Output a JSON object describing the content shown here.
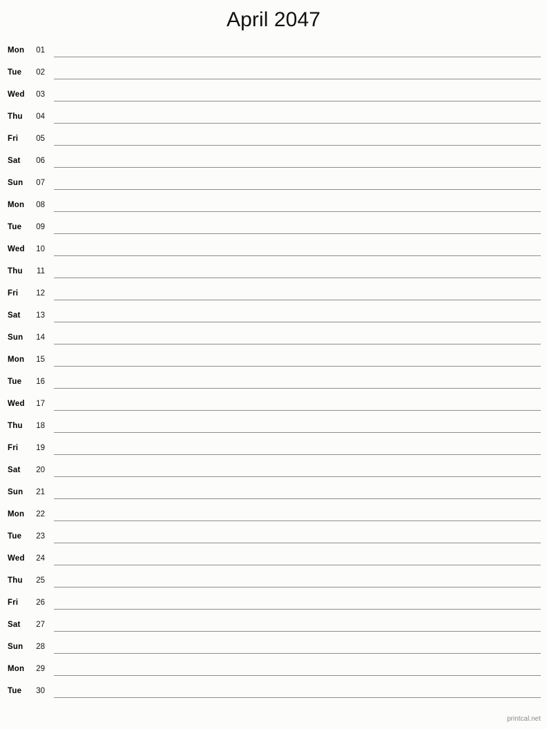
{
  "document": {
    "title": "April 2047",
    "month": "April",
    "year": "2047",
    "type": "printable-notebook-calendar",
    "background_color": "#fcfcfa",
    "line_color": "#8d8d8a",
    "text_color": "#000000"
  },
  "footer": {
    "text": "printcal.net",
    "color": "#8a8a88"
  },
  "days": [
    {
      "weekday": "Mon",
      "date": "01"
    },
    {
      "weekday": "Tue",
      "date": "02"
    },
    {
      "weekday": "Wed",
      "date": "03"
    },
    {
      "weekday": "Thu",
      "date": "04"
    },
    {
      "weekday": "Fri",
      "date": "05"
    },
    {
      "weekday": "Sat",
      "date": "06"
    },
    {
      "weekday": "Sun",
      "date": "07"
    },
    {
      "weekday": "Mon",
      "date": "08"
    },
    {
      "weekday": "Tue",
      "date": "09"
    },
    {
      "weekday": "Wed",
      "date": "10"
    },
    {
      "weekday": "Thu",
      "date": "11"
    },
    {
      "weekday": "Fri",
      "date": "12"
    },
    {
      "weekday": "Sat",
      "date": "13"
    },
    {
      "weekday": "Sun",
      "date": "14"
    },
    {
      "weekday": "Mon",
      "date": "15"
    },
    {
      "weekday": "Tue",
      "date": "16"
    },
    {
      "weekday": "Wed",
      "date": "17"
    },
    {
      "weekday": "Thu",
      "date": "18"
    },
    {
      "weekday": "Fri",
      "date": "19"
    },
    {
      "weekday": "Sat",
      "date": "20"
    },
    {
      "weekday": "Sun",
      "date": "21"
    },
    {
      "weekday": "Mon",
      "date": "22"
    },
    {
      "weekday": "Tue",
      "date": "23"
    },
    {
      "weekday": "Wed",
      "date": "24"
    },
    {
      "weekday": "Thu",
      "date": "25"
    },
    {
      "weekday": "Fri",
      "date": "26"
    },
    {
      "weekday": "Sat",
      "date": "27"
    },
    {
      "weekday": "Sun",
      "date": "28"
    },
    {
      "weekday": "Mon",
      "date": "29"
    },
    {
      "weekday": "Tue",
      "date": "30"
    }
  ]
}
